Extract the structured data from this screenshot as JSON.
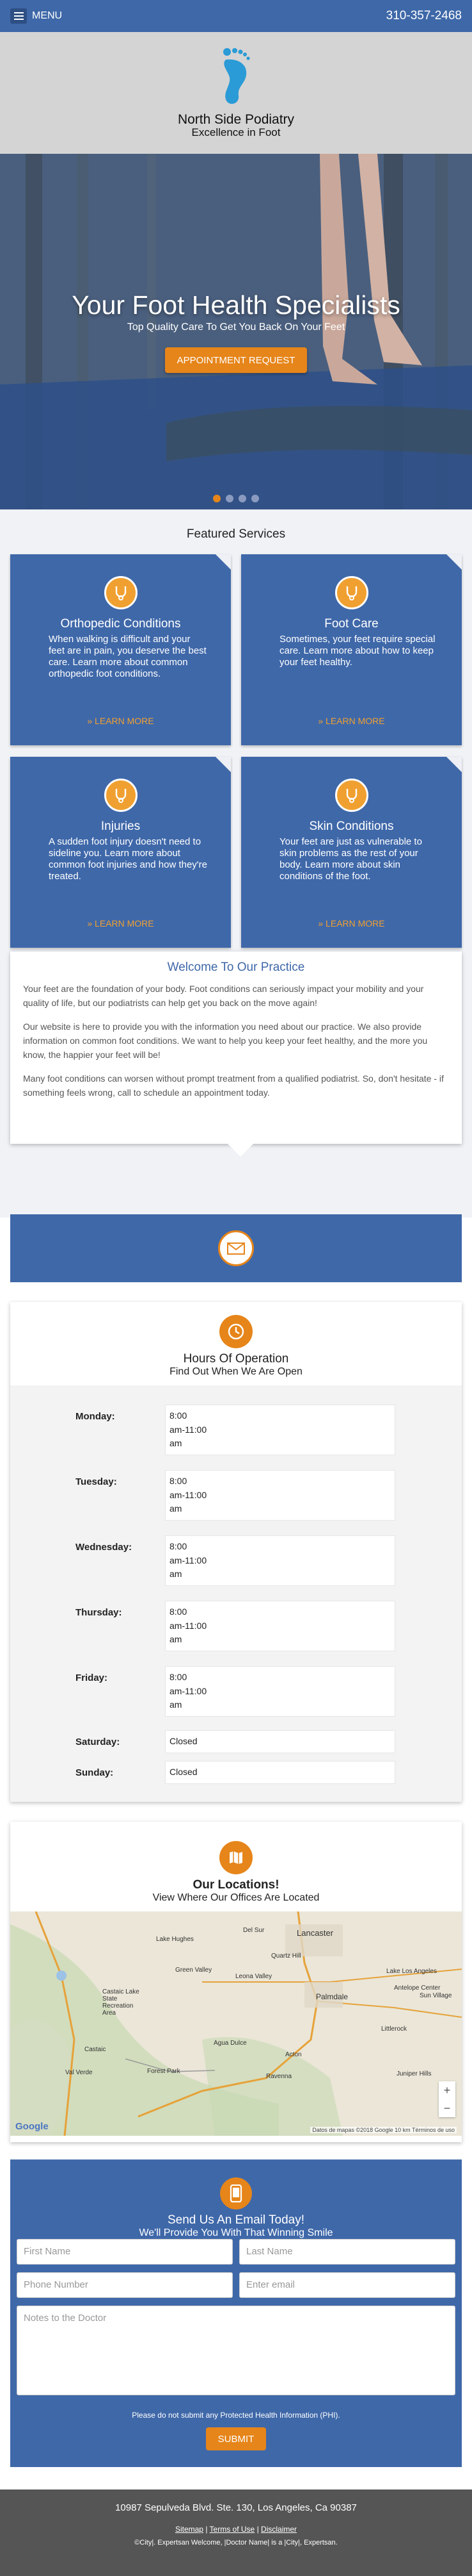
{
  "topbar": {
    "menu_label": "MENU",
    "phone": "310-357-2468"
  },
  "brand": {
    "name": "North Side Podiatry",
    "tagline": "Excellence in Foot"
  },
  "hero": {
    "title": "Your Foot Health Specialists",
    "subtitle": "Top Quality Care To Get You Back On Your Feet",
    "button_label": "APPOINTMENT REQUEST",
    "slide_count": 4,
    "active_slide": 1
  },
  "services": {
    "title": "Featured Services",
    "more_label": "» LEARN MORE",
    "items": [
      {
        "title": "Orthopedic Conditions",
        "text": "When walking is difficult and your feet are in pain, you deserve the best care. Learn more about common orthopedic foot conditions."
      },
      {
        "title": "Foot Care",
        "text": "Sometimes, your feet require special care. Learn more about how to keep your feet healthy."
      },
      {
        "title": "Injuries",
        "text": "A sudden foot injury doesn't need to sideline you. Learn more about common foot injuries and how they're treated."
      },
      {
        "title": "Skin Conditions",
        "text": "Your feet are just as vulnerable to skin problems as the rest of your body. Learn more about skin conditions of the foot."
      }
    ]
  },
  "welcome": {
    "title": "Welcome To Our Practice",
    "p1": "Your feet are the foundation of your body. Foot conditions can seriously impact your mobility and your quality of life, but our podiatrists can help get you back on the move again!",
    "p2": "Our website is here to provide you with the information you need about our practice. We also provide information on common foot conditions. We want to help you keep your feet healthy, and the more you know, the happier your feet will be!",
    "p3": "Many foot conditions can worsen without prompt treatment from a qualified podiatrist. So, don't hesitate - if something feels wrong, call to schedule an appointment today."
  },
  "hours": {
    "title": "Hours Of Operation",
    "subtitle": "Find Out When We Are Open",
    "days": [
      {
        "day": "Monday:",
        "line1": "8:00",
        "line2": "am-11:00",
        "line3": "am"
      },
      {
        "day": "Tuesday:",
        "line1": "8:00",
        "line2": "am-11:00",
        "line3": "am"
      },
      {
        "day": "Wednesday:",
        "line1": "8:00",
        "line2": "am-11:00",
        "line3": "am"
      },
      {
        "day": "Thursday:",
        "line1": "8:00",
        "line2": "am-11:00",
        "line3": "am"
      },
      {
        "day": "Friday:",
        "line1": "8:00",
        "line2": "am-11:00",
        "line3": "am"
      },
      {
        "day": "Saturday:",
        "line1": "Closed"
      },
      {
        "day": "Sunday:",
        "line1": "Closed"
      }
    ]
  },
  "locations": {
    "title": "Our Locations!",
    "subtitle": "View Where Our Offices Are Located",
    "map_labels": [
      "Lancaster",
      "Lake Hughes",
      "Del Sur",
      "Quartz Hill",
      "Green Valley",
      "Leona Valley",
      "Palmdale",
      "Lake Los Angeles",
      "Antelope Center",
      "Sun Village",
      "Castaic Lake State Recreation Area",
      "Castaic",
      "Agua Dulce",
      "Littlerock",
      "Acton",
      "Val Verde",
      "Forest Park",
      "Ravenna",
      "Juniper Hills"
    ],
    "google_label": "Google",
    "attribution": "Datos de mapas ©2018 Google   10 km   Términos de uso"
  },
  "contact": {
    "title": "Send Us An Email Today!",
    "subtitle": "We'll Provide You With That Winning Smile",
    "first_name": "First Name",
    "last_name": "Last Name",
    "phone": "Phone Number",
    "email": "Enter email",
    "notes": "Notes to the Doctor",
    "disclaimer": "Please do not submit any Protected Health Information (PHI).",
    "submit_label": "SUBMIT"
  },
  "footer": {
    "address": "10987 Sepulveda Blvd. Ste. 130, Los Angeles, Ca 90387",
    "links": [
      "Sitemap",
      "Terms of Use",
      "Disclaimer"
    ],
    "copyright": "©City|. Expertsan Welcome, |Doctor Name| is a |City|, Expertsan."
  },
  "colors": {
    "primary": "#3e68a8",
    "accent": "#e6851a"
  }
}
